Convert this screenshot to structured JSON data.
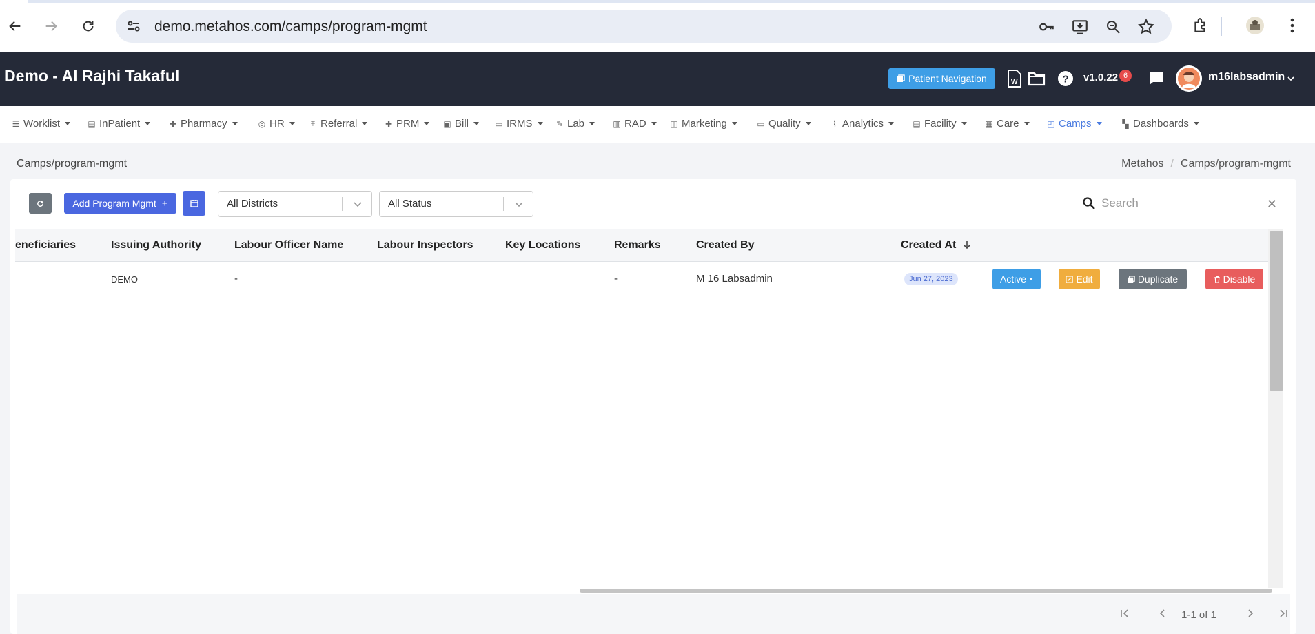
{
  "browser": {
    "url": "demo.metahos.com/camps/program-mgmt"
  },
  "app": {
    "title": "Demo - Al Rajhi Takaful",
    "patient_nav_label": "Patient Navigation",
    "version": "v1.0.22",
    "notification_count": "6",
    "username": "m16labsadmin"
  },
  "menu": [
    {
      "label": "Worklist",
      "icon": "list-icon"
    },
    {
      "label": "InPatient",
      "icon": "document-icon"
    },
    {
      "label": "Pharmacy",
      "icon": "plus-icon"
    },
    {
      "label": "HR",
      "icon": "user-circle-icon"
    },
    {
      "label": "Referral",
      "icon": "user-list-icon"
    },
    {
      "label": "PRM",
      "icon": "plus-icon"
    },
    {
      "label": "Bill",
      "icon": "bill-icon"
    },
    {
      "label": "IRMS",
      "icon": "id-card-icon"
    },
    {
      "label": "Lab",
      "icon": "pencil-icon"
    },
    {
      "label": "RAD",
      "icon": "film-icon"
    },
    {
      "label": "Marketing",
      "icon": "bag-icon"
    },
    {
      "label": "Quality",
      "icon": "id-card-icon"
    },
    {
      "label": "Analytics",
      "icon": "pulse-icon"
    },
    {
      "label": "Facility",
      "icon": "document-icon"
    },
    {
      "label": "Care",
      "icon": "calendar-icon"
    },
    {
      "label": "Camps",
      "icon": "briefcase-icon",
      "active": true
    },
    {
      "label": "Dashboards",
      "icon": "grid-icon"
    }
  ],
  "page": {
    "path": "Camps/program-mgmt",
    "breadcrumb": [
      "Metahos",
      "Camps/program-mgmt"
    ]
  },
  "toolbar": {
    "add_label": "Add Program Mgmt",
    "district_select": "All Districts",
    "status_select": "All Status",
    "search_placeholder": "Search"
  },
  "table": {
    "columns": [
      "eneficiaries",
      "Issuing Authority",
      "Labour Officer Name",
      "Labour Inspectors",
      "Key Locations",
      "Remarks",
      "Created By",
      "Created At"
    ],
    "rows": [
      {
        "beneficiaries": "",
        "issuing_authority": "DEMO",
        "labour_officer": "-",
        "labour_inspectors": "",
        "key_locations": "",
        "remarks": "-",
        "created_by": "M 16 Labsadmin",
        "created_at": "Jun 27, 2023",
        "status_label": "Active",
        "edit_label": "Edit",
        "duplicate_label": "Duplicate",
        "disable_label": "Disable"
      }
    ]
  },
  "pagination": {
    "text": "1-1 of 1"
  },
  "colors": {
    "header_bg": "#252a38",
    "primary": "#4a67e0",
    "active": "#3e9ee6",
    "edit": "#f0ad3e",
    "duplicate": "#6c757d",
    "disable": "#e85d5d"
  }
}
